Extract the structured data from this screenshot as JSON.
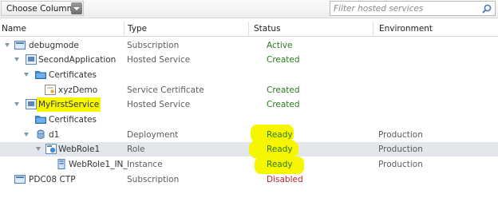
{
  "toolbar": {
    "choose_columns_label": "Choose Columns",
    "search_placeholder": "Filter hosted services"
  },
  "columns": {
    "name": "Name",
    "type": "Type",
    "status": "Status",
    "environment": "Environment"
  },
  "rows": [
    {
      "name": "debugmode",
      "type": "Subscription",
      "status": "Active",
      "environment": ""
    },
    {
      "name": "SecondApplication",
      "type": "Hosted Service",
      "status": "Created",
      "environment": ""
    },
    {
      "name": "Certificates",
      "type": "",
      "status": "",
      "environment": ""
    },
    {
      "name": "xyzDemo",
      "type": "Service Certificate",
      "status": "Created",
      "environment": ""
    },
    {
      "name": "MyFirstService",
      "type": "Hosted Service",
      "status": "Created",
      "environment": ""
    },
    {
      "name": "Certificates",
      "type": "",
      "status": "",
      "environment": ""
    },
    {
      "name": "d1",
      "type": "Deployment",
      "status": "Ready",
      "environment": "Production"
    },
    {
      "name": "WebRole1",
      "type": "Role",
      "status": "Ready",
      "environment": "Production"
    },
    {
      "name": "WebRole1_IN_",
      "type": "Instance",
      "status": "Ready",
      "environment": "Production"
    },
    {
      "name": "PDC08 CTP",
      "type": "Subscription",
      "status": "Disabled",
      "environment": ""
    }
  ],
  "colors": {
    "status_ok": "#2b7a1f",
    "status_disabled": "#c4212f",
    "highlight": "#f6f600",
    "selected_row": "#e3e6ea"
  },
  "icons": [
    "chevron-down-icon",
    "search-icon",
    "expand-arrow-icon",
    "subscription-icon",
    "hosted-service-icon",
    "folder-icon",
    "certificate-icon",
    "deployment-icon",
    "role-icon",
    "instance-icon"
  ]
}
